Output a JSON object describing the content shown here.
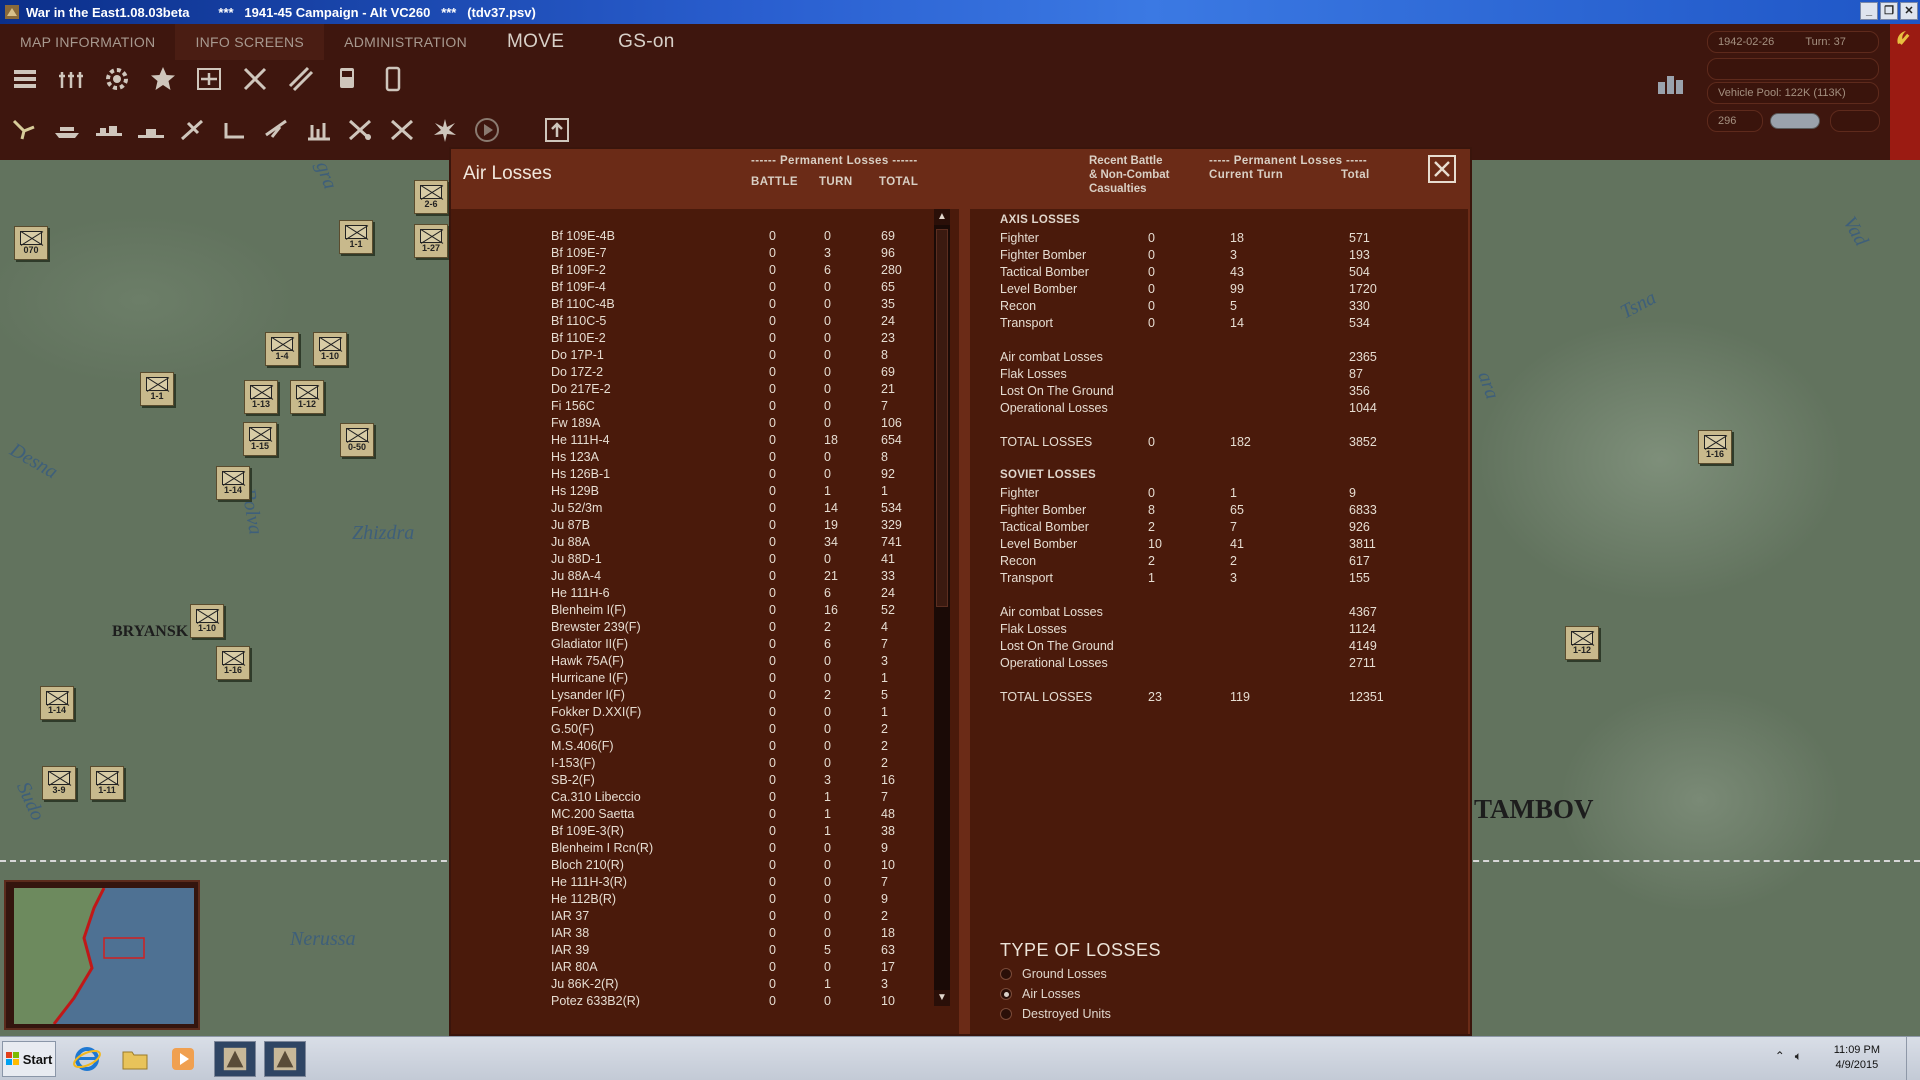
{
  "window": {
    "title": "War in the East1.08.03beta        ***   1941-45 Campaign - Alt VC260   ***   (tdv37.psv)",
    "btn_min": "_",
    "btn_restore": "❐",
    "btn_close": "✕"
  },
  "menu": {
    "map_information": "MAP INFORMATION",
    "info_screens": "INFO SCREENS",
    "administration": "ADMINISTRATION",
    "move": "MOVE",
    "gs_on": "GS-on"
  },
  "status": {
    "date": "1942-02-26",
    "turn": "Turn: 37",
    "vehicle_pool": "Vehicle Pool: 122K (113K)",
    "counter": "296"
  },
  "map": {
    "labels": {
      "desna": "Desna",
      "bolva": "Bolva",
      "zhizdra": "Zhizdra",
      "nerussa": "Nerussa",
      "sudost": "Sudo",
      "tsna": "Tsna",
      "vad": "Vad",
      "vara": "ara",
      "ugra": "gra"
    },
    "cities": {
      "bryansk": "BRYANSK",
      "tambov": "TAMBOV"
    },
    "units": [
      {
        "label": "1-1"
      },
      {
        "label": "1-4"
      },
      {
        "label": "1-10"
      },
      {
        "label": "1-1"
      },
      {
        "label": "1-13"
      },
      {
        "label": "1-12"
      },
      {
        "label": "1-15"
      },
      {
        "label": "0-50"
      },
      {
        "label": "1-14"
      },
      {
        "label": "1-10"
      },
      {
        "label": "1-16"
      },
      {
        "label": "1-14"
      },
      {
        "label": "3-9"
      },
      {
        "label": "1-11"
      },
      {
        "label": "070"
      },
      {
        "label": "1-27"
      },
      {
        "label": "1-16"
      },
      {
        "label": "1-12"
      },
      {
        "label": "2-6"
      }
    ]
  },
  "dialog": {
    "title": "Air Losses",
    "left_header": {
      "group": "------ Permanent Losses ------",
      "battle": "BATTLE",
      "turn": "TURN",
      "total": "TOTAL"
    },
    "right_header": {
      "recent_l1": "Recent Battle",
      "recent_l2": "& Non-Combat",
      "recent_l3": "Casualties",
      "group": "----- Permanent Losses -----",
      "current": "Current Turn",
      "total": "Total"
    },
    "aircraft": [
      {
        "name": "Bf 109E-4B",
        "battle": "0",
        "turn": "0",
        "total": "69"
      },
      {
        "name": "Bf 109E-7",
        "battle": "0",
        "turn": "3",
        "total": "96"
      },
      {
        "name": "Bf 109F-2",
        "battle": "0",
        "turn": "6",
        "total": "280"
      },
      {
        "name": "Bf 109F-4",
        "battle": "0",
        "turn": "0",
        "total": "65"
      },
      {
        "name": "Bf 110C-4B",
        "battle": "0",
        "turn": "0",
        "total": "35"
      },
      {
        "name": "Bf 110C-5",
        "battle": "0",
        "turn": "0",
        "total": "24"
      },
      {
        "name": "Bf 110E-2",
        "battle": "0",
        "turn": "0",
        "total": "23"
      },
      {
        "name": "Do 17P-1",
        "battle": "0",
        "turn": "0",
        "total": "8"
      },
      {
        "name": "Do 17Z-2",
        "battle": "0",
        "turn": "0",
        "total": "69"
      },
      {
        "name": "Do 217E-2",
        "battle": "0",
        "turn": "0",
        "total": "21"
      },
      {
        "name": "Fi 156C",
        "battle": "0",
        "turn": "0",
        "total": "7"
      },
      {
        "name": "Fw 189A",
        "battle": "0",
        "turn": "0",
        "total": "106"
      },
      {
        "name": "He 111H-4",
        "battle": "0",
        "turn": "18",
        "total": "654"
      },
      {
        "name": "Hs 123A",
        "battle": "0",
        "turn": "0",
        "total": "8"
      },
      {
        "name": "Hs 126B-1",
        "battle": "0",
        "turn": "0",
        "total": "92"
      },
      {
        "name": "Hs 129B",
        "battle": "0",
        "turn": "1",
        "total": "1"
      },
      {
        "name": "Ju 52/3m",
        "battle": "0",
        "turn": "14",
        "total": "534"
      },
      {
        "name": "Ju 87B",
        "battle": "0",
        "turn": "19",
        "total": "329"
      },
      {
        "name": "Ju 88A",
        "battle": "0",
        "turn": "34",
        "total": "741"
      },
      {
        "name": "Ju 88D-1",
        "battle": "0",
        "turn": "0",
        "total": "41"
      },
      {
        "name": "Ju 88A-4",
        "battle": "0",
        "turn": "21",
        "total": "33"
      },
      {
        "name": "He 111H-6",
        "battle": "0",
        "turn": "6",
        "total": "24"
      },
      {
        "name": "Blenheim I(F)",
        "battle": "0",
        "turn": "16",
        "total": "52"
      },
      {
        "name": "Brewster 239(F)",
        "battle": "0",
        "turn": "2",
        "total": "4"
      },
      {
        "name": "Gladiator II(F)",
        "battle": "0",
        "turn": "6",
        "total": "7"
      },
      {
        "name": "Hawk 75A(F)",
        "battle": "0",
        "turn": "0",
        "total": "3"
      },
      {
        "name": "Hurricane I(F)",
        "battle": "0",
        "turn": "0",
        "total": "1"
      },
      {
        "name": "Lysander I(F)",
        "battle": "0",
        "turn": "2",
        "total": "5"
      },
      {
        "name": "Fokker D.XXI(F)",
        "battle": "0",
        "turn": "0",
        "total": "1"
      },
      {
        "name": "G.50(F)",
        "battle": "0",
        "turn": "0",
        "total": "2"
      },
      {
        "name": "M.S.406(F)",
        "battle": "0",
        "turn": "0",
        "total": "2"
      },
      {
        "name": "I-153(F)",
        "battle": "0",
        "turn": "0",
        "total": "2"
      },
      {
        "name": "SB-2(F)",
        "battle": "0",
        "turn": "3",
        "total": "16"
      },
      {
        "name": "Ca.310 Libeccio",
        "battle": "0",
        "turn": "1",
        "total": "7"
      },
      {
        "name": "MC.200 Saetta",
        "battle": "0",
        "turn": "1",
        "total": "48"
      },
      {
        "name": "Bf 109E-3(R)",
        "battle": "0",
        "turn": "1",
        "total": "38"
      },
      {
        "name": "Blenheim I Rcn(R)",
        "battle": "0",
        "turn": "0",
        "total": "9"
      },
      {
        "name": "Bloch 210(R)",
        "battle": "0",
        "turn": "0",
        "total": "10"
      },
      {
        "name": "He 111H-3(R)",
        "battle": "0",
        "turn": "0",
        "total": "7"
      },
      {
        "name": "He 112B(R)",
        "battle": "0",
        "turn": "0",
        "total": "9"
      },
      {
        "name": "IAR 37",
        "battle": "0",
        "turn": "0",
        "total": "2"
      },
      {
        "name": "IAR 38",
        "battle": "0",
        "turn": "0",
        "total": "18"
      },
      {
        "name": "IAR 39",
        "battle": "0",
        "turn": "5",
        "total": "63"
      },
      {
        "name": "IAR 80A",
        "battle": "0",
        "turn": "0",
        "total": "17"
      },
      {
        "name": "Ju 86K-2(R)",
        "battle": "0",
        "turn": "1",
        "total": "3"
      },
      {
        "name": "Potez 633B2(R)",
        "battle": "0",
        "turn": "0",
        "total": "10"
      }
    ],
    "axis": {
      "heading": "AXIS LOSSES",
      "types": [
        {
          "label": "Fighter",
          "recent": "0",
          "current": "18",
          "total": "571"
        },
        {
          "label": "Fighter Bomber",
          "recent": "0",
          "current": "3",
          "total": "193"
        },
        {
          "label": "Tactical Bomber",
          "recent": "0",
          "current": "43",
          "total": "504"
        },
        {
          "label": "Level Bomber",
          "recent": "0",
          "current": "99",
          "total": "1720"
        },
        {
          "label": "Recon",
          "recent": "0",
          "current": "5",
          "total": "330"
        },
        {
          "label": "Transport",
          "recent": "0",
          "current": "14",
          "total": "534"
        }
      ],
      "causes": [
        {
          "label": "Air combat Losses",
          "total": "2365"
        },
        {
          "label": "Flak Losses",
          "total": "87"
        },
        {
          "label": "Lost On The Ground",
          "total": "356"
        },
        {
          "label": "Operational Losses",
          "total": "1044"
        }
      ],
      "totals": {
        "label": "TOTAL LOSSES",
        "recent": "0",
        "current": "182",
        "total": "3852"
      }
    },
    "soviet": {
      "heading": "SOVIET LOSSES",
      "types": [
        {
          "label": "Fighter",
          "recent": "0",
          "current": "1",
          "total": "9"
        },
        {
          "label": "Fighter Bomber",
          "recent": "8",
          "current": "65",
          "total": "6833"
        },
        {
          "label": "Tactical Bomber",
          "recent": "2",
          "current": "7",
          "total": "926"
        },
        {
          "label": "Level Bomber",
          "recent": "10",
          "current": "41",
          "total": "3811"
        },
        {
          "label": "Recon",
          "recent": "2",
          "current": "2",
          "total": "617"
        },
        {
          "label": "Transport",
          "recent": "1",
          "current": "3",
          "total": "155"
        }
      ],
      "causes": [
        {
          "label": "Air combat Losses",
          "total": "4367"
        },
        {
          "label": "Flak Losses",
          "total": "1124"
        },
        {
          "label": "Lost On The Ground",
          "total": "4149"
        },
        {
          "label": "Operational Losses",
          "total": "2711"
        }
      ],
      "totals": {
        "label": "TOTAL LOSSES",
        "recent": "23",
        "current": "119",
        "total": "12351"
      }
    },
    "type_of_losses": {
      "title": "TYPE OF LOSSES",
      "options": [
        {
          "label": "Ground Losses",
          "selected": false
        },
        {
          "label": "Air Losses",
          "selected": true
        },
        {
          "label": "Destroyed Units",
          "selected": false
        }
      ]
    }
  },
  "taskbar": {
    "start": "Start",
    "time": "11:09 PM",
    "date": "4/9/2015"
  }
}
